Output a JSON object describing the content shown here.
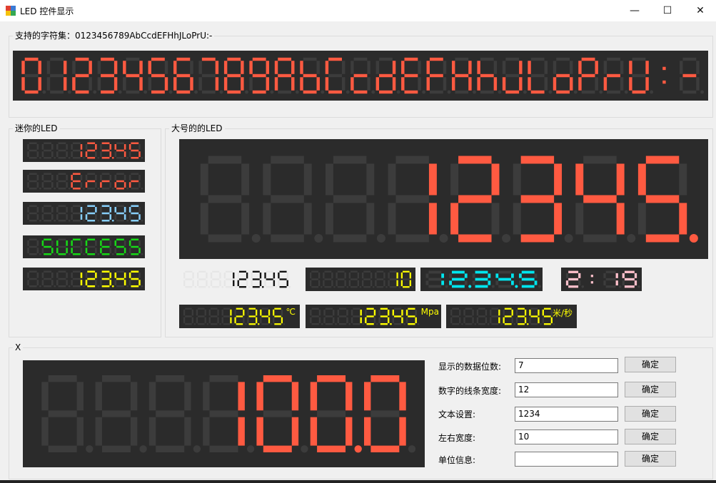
{
  "window": {
    "title": "LED 控件显示",
    "minimize_icon": "minimize-icon",
    "maximize_icon": "maximize-icon",
    "close_icon": "close-icon"
  },
  "top_group": {
    "label": "支持的字符集：0123456789AbCcdEFHhJLoPrU:-"
  },
  "mini_group": {
    "label": "迷你的LED"
  },
  "large_group": {
    "label": "大号的的LED"
  },
  "x_group": {
    "label": "X"
  },
  "leds": {
    "charset": {
      "text": "0123456789AbCcdEFHhJLoPrU:-",
      "digits": 27,
      "color": "#ff5a41"
    },
    "mini1": {
      "text": "123.45",
      "digits": 8,
      "color": "#ff5a41"
    },
    "mini2": {
      "text": "Error",
      "digits": 8,
      "color": "#ff5a41"
    },
    "mini3": {
      "text": "123.45",
      "digits": 8,
      "color": "#87cefa"
    },
    "mini4": {
      "text": "SUCCESS",
      "digits": 8,
      "color": "#17d817"
    },
    "mini5": {
      "text": "123.45",
      "digits": 8,
      "color": "#ffff00"
    },
    "big": {
      "text": "12345.",
      "digits": 8,
      "color": "#ff5a41"
    },
    "light": {
      "text": "123.45",
      "digits": 8,
      "color": "#111111"
    },
    "ten": {
      "text": "10",
      "digits": 8,
      "color": "#ffff00"
    },
    "cyan": {
      "text": "12.34.5",
      "digits": 5,
      "color": "#00e5ee"
    },
    "clock": {
      "text": "22:19",
      "digits": 4,
      "color": "#ffc0cb"
    },
    "celsius": {
      "text": "123.45",
      "digits": 8,
      "color": "#ffff00",
      "unit": "℃"
    },
    "mpa": {
      "text": "123.45",
      "digits": 8,
      "color": "#ffff00",
      "unit": "Mpa"
    },
    "speed": {
      "text": "123.45",
      "digits": 8,
      "color": "#ffff00",
      "unit": "米/秒"
    },
    "x": {
      "text": "100.0",
      "digits": 7,
      "color": "#ff5a41"
    }
  },
  "form": {
    "rows": [
      {
        "label": "显示的数据位数:",
        "value": "7",
        "button": "确定"
      },
      {
        "label": "数字的线条宽度:",
        "value": "12",
        "button": "确定"
      },
      {
        "label": "文本设置:",
        "value": "1234",
        "button": "确定"
      },
      {
        "label": "左右宽度:",
        "value": "10",
        "button": "确定"
      },
      {
        "label": "单位信息:",
        "value": "",
        "button": "确定"
      }
    ]
  }
}
